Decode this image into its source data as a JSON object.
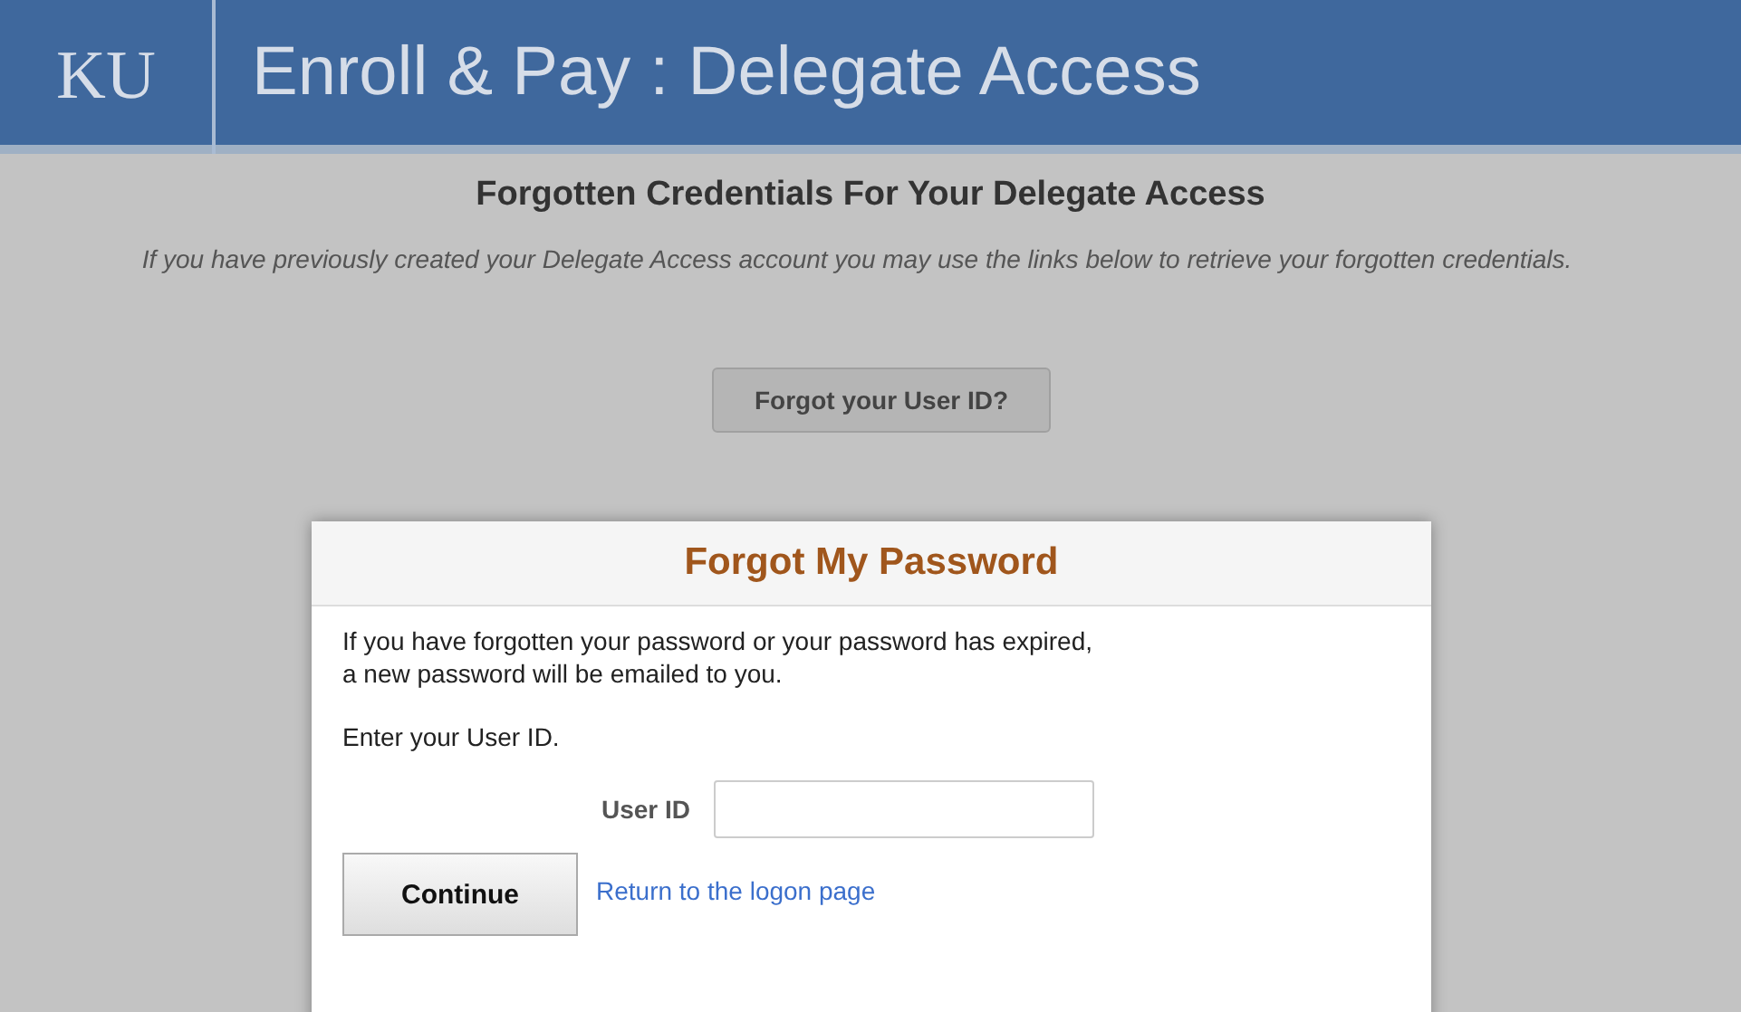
{
  "header": {
    "logo": "KU",
    "title": "Enroll & Pay : Delegate Access"
  },
  "page": {
    "heading": "Forgotten Credentials For Your Delegate Access",
    "intro": "If you have previously created your Delegate Access account you may use the links below to retrieve your forgotten credentials.",
    "buttons": [
      "Forgot your User ID?"
    ]
  },
  "dialog": {
    "title": "Forgot My Password",
    "message": "If you have forgotten your password or your password has expired,\na new password will be emailed to you.",
    "prompt": "Enter your User ID.",
    "field_label": "User ID",
    "continue_button": "Continue",
    "link": "Return to the logon page"
  }
}
